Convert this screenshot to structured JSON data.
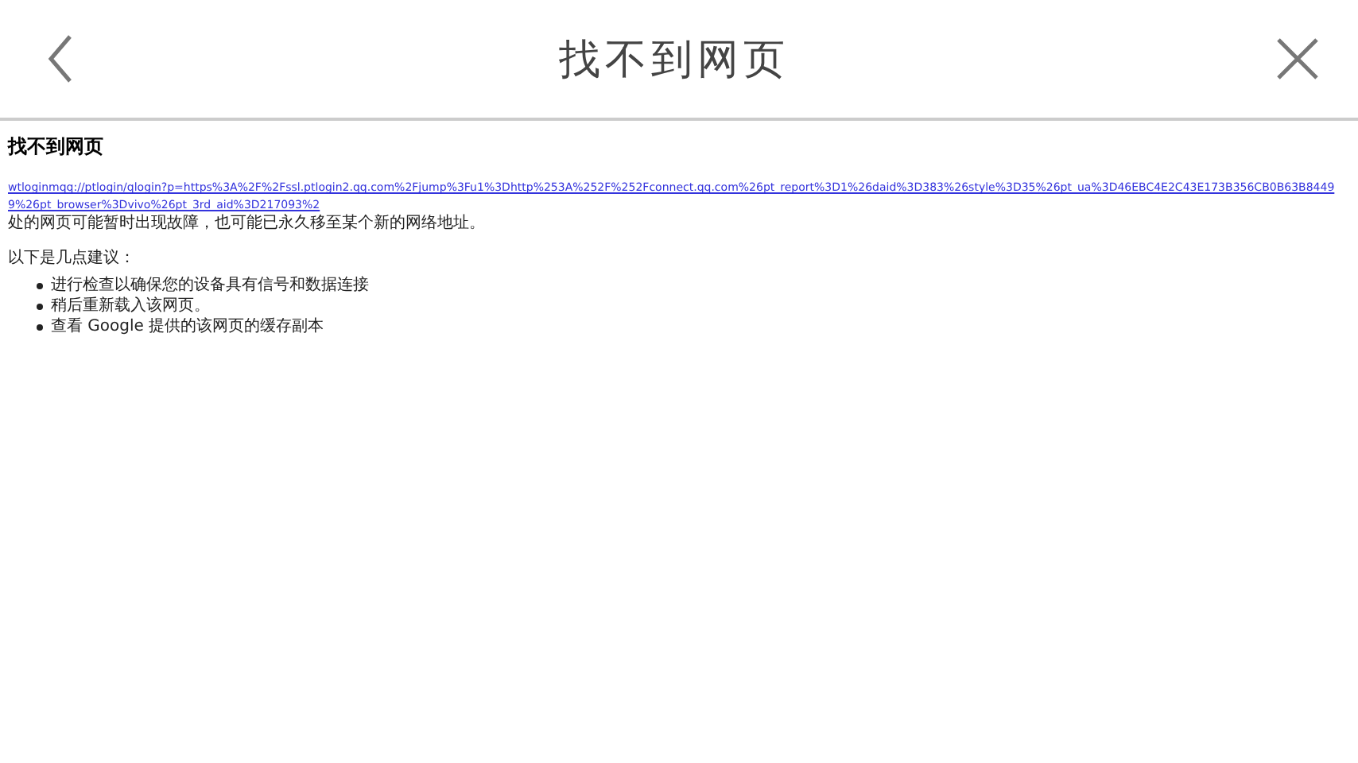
{
  "header": {
    "title": "找不到网页"
  },
  "page": {
    "heading": "找不到网页",
    "link": "wtloginmqq://ptlogin/qlogin?p=https%3A%2F%2Fssl.ptlogin2.qq.com%2Fjump%3Fu1%3Dhttp%253A%252F%252Fconnect.qq.com%26pt_report%3D1%26daid%3D383%26style%3D35%26pt_ua%3D46EBC4E2C43E173B356CB0B63B84499%26pt_browser%3Dvivo%26pt_3rd_aid%3D217093%2",
    "message": "处的网页可能暂时出现故障，也可能已永久移至某个新的网络地址。",
    "suggestions_intro": "以下是几点建议：",
    "suggestions": [
      "进行检查以确保您的设备具有信号和数据连接",
      "稍后重新载入该网页。",
      "查看 Google 提供的该网页的缓存副本"
    ]
  }
}
